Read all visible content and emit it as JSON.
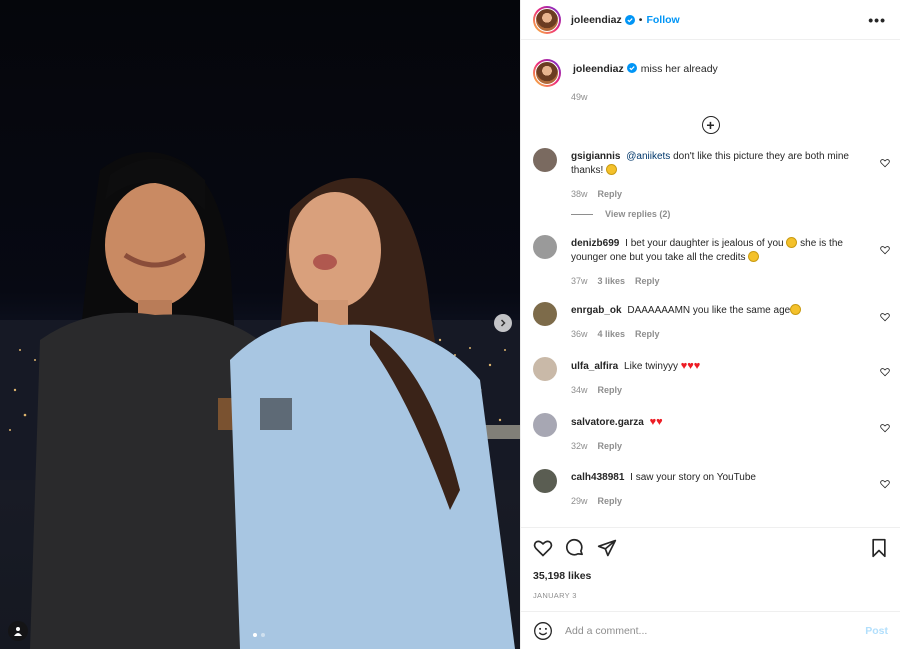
{
  "post": {
    "username": "joleendiaz",
    "follow_label": "Follow",
    "separator": "•",
    "more_label": "•••",
    "caption": "miss her already",
    "caption_time": "49w",
    "likes": "35,198 likes",
    "date": "JANUARY 3",
    "carousel": {
      "count": 2,
      "current": 1
    }
  },
  "comments": [
    {
      "user": "gsigiannis",
      "mention": "@aniikets",
      "text": " don't like this picture they are both mine thanks! ",
      "time": "38w",
      "likes": "",
      "reply_label": "Reply",
      "view_replies": "View replies (2)",
      "avatar_color": "#7a6a60"
    },
    {
      "user": "denizb699",
      "text_1": "I bet your daughter is jealous of you ",
      "text_2": " she is the younger one but you take all the credits ",
      "time": "37w",
      "likes": "3 likes",
      "reply_label": "Reply",
      "avatar_color": "#9a9a9a"
    },
    {
      "user": "enrgab_ok",
      "text": "DAAAAAAMN you like the same age",
      "time": "36w",
      "likes": "4 likes",
      "reply_label": "Reply",
      "avatar_color": "#7d6b4a"
    },
    {
      "user": "ulfa_alfira",
      "text": "Like twinyyy ",
      "hearts": "♥♥♥",
      "time": "34w",
      "likes": "",
      "reply_label": "Reply",
      "avatar_color": "#c9b9a8"
    },
    {
      "user": "salvatore.garza",
      "text": "",
      "hearts": "♥♥",
      "time": "32w",
      "likes": "",
      "reply_label": "Reply",
      "avatar_color": "#a7a7b3"
    },
    {
      "user": "calh438981",
      "text": "I saw your story on YouTube",
      "time": "29w",
      "likes": "",
      "reply_label": "Reply",
      "avatar_color": "#5a5d52"
    }
  ],
  "add_comment": {
    "placeholder": "Add a comment...",
    "post_label": "Post"
  },
  "colors": {
    "accent": "#0095f6",
    "muted": "#8e8e8e",
    "post_disabled": "#b2dffc",
    "heart": "#ed1c24"
  },
  "icons": [
    "verified-badge-icon",
    "more-options-icon",
    "load-more-icon",
    "heart-outline-icon",
    "comment-icon",
    "share-icon",
    "bookmark-icon",
    "emoji-icon",
    "next-arrow-icon",
    "tag-people-icon"
  ]
}
